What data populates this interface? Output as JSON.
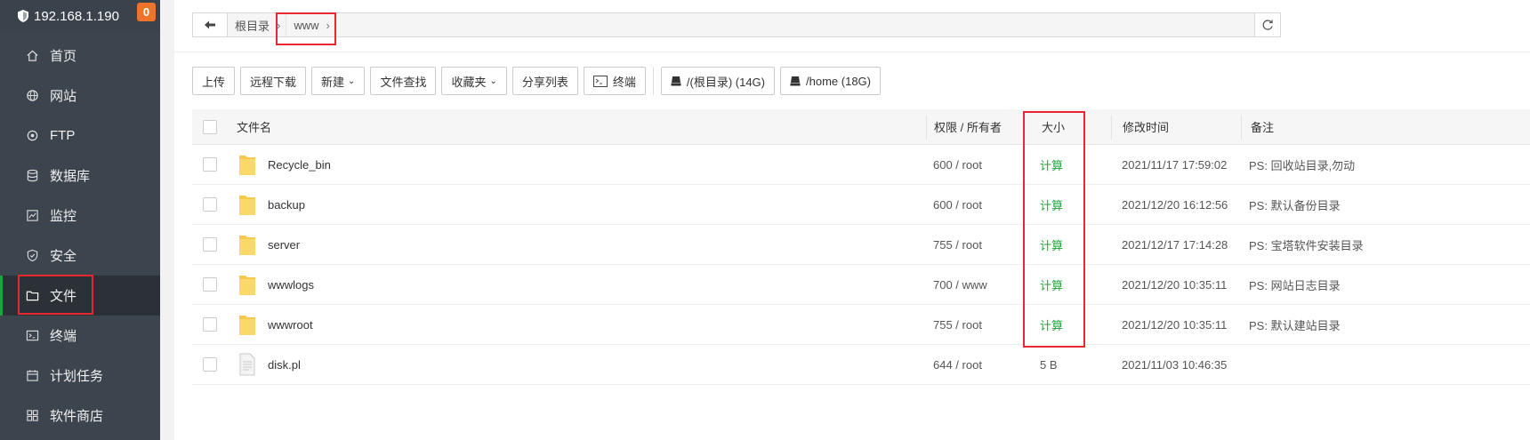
{
  "server": {
    "ip": "192.168.1.190",
    "badge": "0"
  },
  "sidebar": {
    "items": [
      {
        "label": "首页",
        "icon": "home-icon"
      },
      {
        "label": "网站",
        "icon": "globe-icon"
      },
      {
        "label": "FTP",
        "icon": "ftp-icon"
      },
      {
        "label": "数据库",
        "icon": "database-icon"
      },
      {
        "label": "监控",
        "icon": "monitor-icon"
      },
      {
        "label": "安全",
        "icon": "shield-icon"
      },
      {
        "label": "文件",
        "icon": "folder-icon",
        "active": true
      },
      {
        "label": "终端",
        "icon": "terminal-icon"
      },
      {
        "label": "计划任务",
        "icon": "calendar-icon"
      },
      {
        "label": "软件商店",
        "icon": "apps-icon"
      }
    ]
  },
  "breadcrumb": {
    "root": "根目录",
    "current": "www"
  },
  "toolbar": {
    "upload": "上传",
    "remote_download": "远程下载",
    "new": "新建",
    "file_search": "文件查找",
    "favorites": "收藏夹",
    "share_list": "分享列表",
    "terminal": "终端",
    "disk_root": "/(根目录) (14G)",
    "disk_home": "/home (18G)"
  },
  "table": {
    "headers": {
      "name": "文件名",
      "perm": "权限 / 所有者",
      "size": "大小",
      "mtime": "修改时间",
      "note": "备注"
    },
    "rows": [
      {
        "type": "folder",
        "name": "Recycle_bin",
        "perm": "600 / root",
        "size": "计算",
        "mtime": "2021/11/17 17:59:02",
        "note": "PS: 回收站目录,勿动"
      },
      {
        "type": "folder",
        "name": "backup",
        "perm": "600 / root",
        "size": "计算",
        "mtime": "2021/12/20 16:12:56",
        "note": "PS: 默认备份目录"
      },
      {
        "type": "folder",
        "name": "server",
        "perm": "755 / root",
        "size": "计算",
        "mtime": "2021/12/17 17:14:28",
        "note": "PS: 宝塔软件安装目录"
      },
      {
        "type": "folder",
        "name": "wwwlogs",
        "perm": "700 / www",
        "size": "计算",
        "mtime": "2021/12/20 10:35:11",
        "note": "PS: 网站日志目录"
      },
      {
        "type": "folder",
        "name": "wwwroot",
        "perm": "755 / root",
        "size": "计算",
        "mtime": "2021/12/20 10:35:11",
        "note": "PS: 默认建站目录"
      },
      {
        "type": "file",
        "name": "disk.pl",
        "perm": "644 / root",
        "size": "5 B",
        "mtime": "2021/11/03 10:46:35",
        "note": ""
      }
    ]
  },
  "colors": {
    "sidebar_bg": "#3c444d",
    "accent_green": "#20a53a",
    "badge_orange": "#f0732b",
    "annotation_red": "#e8272e"
  }
}
